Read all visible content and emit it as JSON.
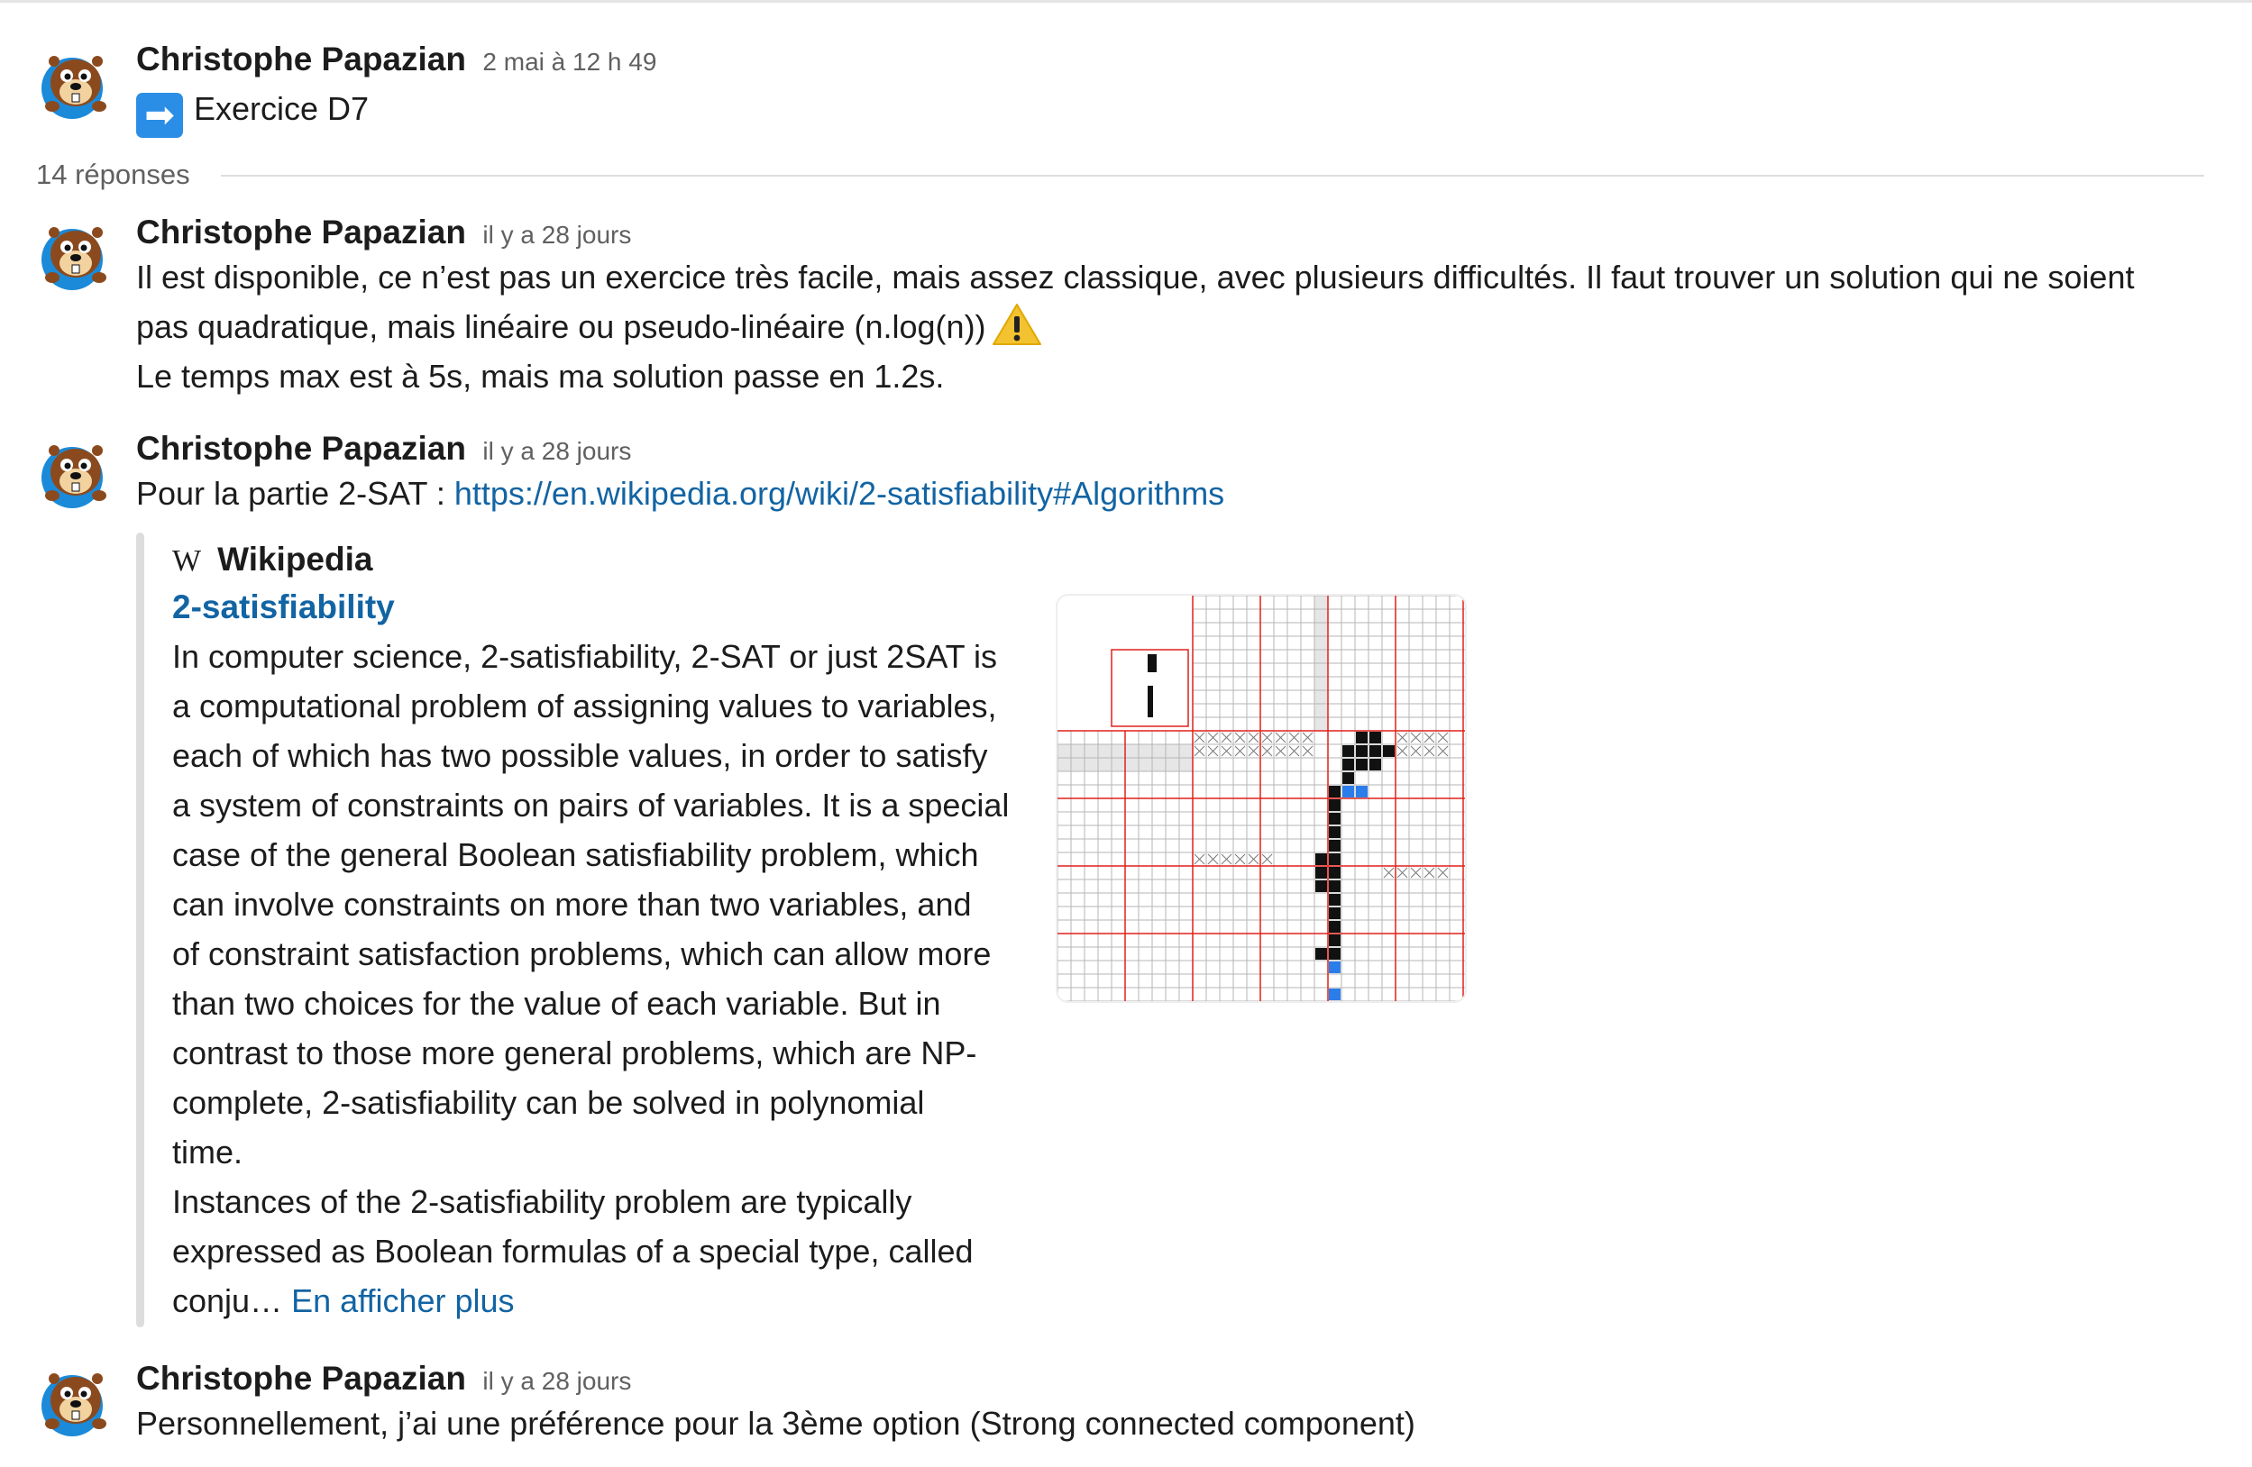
{
  "thread": {
    "parent": {
      "author": "Christophe Papazian",
      "timestamp": "2 mai à 12 h 49",
      "emoji": "arrow-right-emoji",
      "text": "Exercice D7"
    },
    "replies_count_label": "14 réponses",
    "replies": [
      {
        "author": "Christophe Papazian",
        "timestamp": "il y a 28 jours",
        "line1": "Il est disponible, ce n’est pas un exercice très facile, mais assez classique, avec plusieurs difficultés. Il faut trouver un solution qui ne soient",
        "line2": "pas quadratique, mais linéaire ou pseudo-linéaire (n.log(n))",
        "emoji": "warning-emoji",
        "line3": "Le temps max est à 5s, mais ma solution passe en 1.2s."
      },
      {
        "author": "Christophe Papazian",
        "timestamp": "il y a 28 jours",
        "text_prefix": "Pour la partie 2-SAT : ",
        "link": "https://en.wikipedia.org/wiki/2-satisfiability#Algorithms",
        "attachment": {
          "service_icon": "W",
          "service_name": "Wikipedia",
          "title": "2-satisfiability",
          "lines": [
            "In computer science, 2-satisfiability, 2-SAT or just 2SAT is",
            "a computational problem of assigning values to variables,",
            "each of which has two possible values, in order to satisfy",
            "a system of constraints on pairs of variables. It is a special",
            "case of the general Boolean satisfiability problem, which",
            "can involve constraints on more than two variables, and",
            "of constraint satisfaction problems, which can allow more",
            "than two choices for the value of each variable. But in",
            "contrast to those more general problems, which are NP-",
            "complete, 2-satisfiability can be solved in polynomial",
            "time.",
            "Instances of the 2-satisfiability problem are typically",
            "expressed as Boolean formulas of a special type, called"
          ],
          "last_line_prefix": "conju… ",
          "show_more": "En afficher plus",
          "image": "nonogram-puzzle-image"
        }
      },
      {
        "author": "Christophe Papazian",
        "timestamp": "il y a 28 jours",
        "text": "Personnellement, j’ai une préférence pour la 3ème option (Strong connected component)"
      }
    ]
  },
  "colors": {
    "link": "#1264a3",
    "text": "#1d1c1d",
    "muted": "#616061",
    "grid_red": "#e0201c",
    "cell_blue": "#2b7de9"
  }
}
